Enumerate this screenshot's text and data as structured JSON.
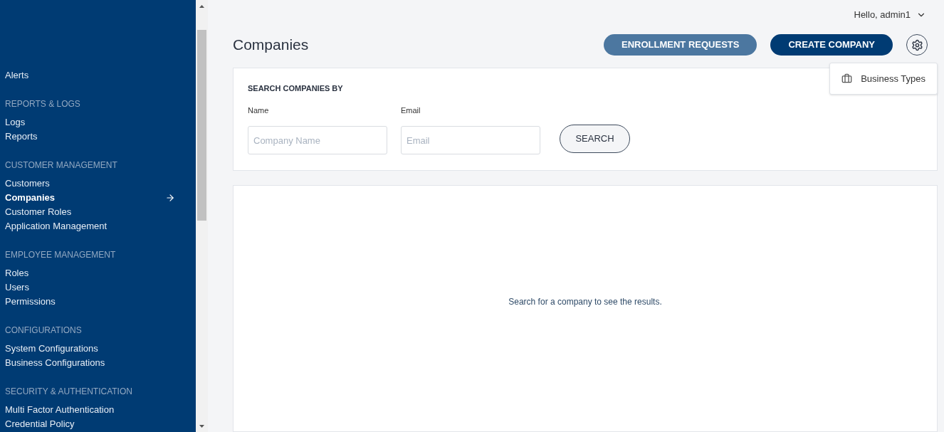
{
  "sidebar": {
    "groups": [
      {
        "items": [
          {
            "label": "Alerts",
            "selected": false
          }
        ]
      },
      {
        "header": "REPORTS & LOGS",
        "items": [
          {
            "label": "Logs",
            "selected": false
          },
          {
            "label": "Reports",
            "selected": false
          }
        ]
      },
      {
        "header": "CUSTOMER MANAGEMENT",
        "items": [
          {
            "label": "Customers",
            "selected": false
          },
          {
            "label": "Companies",
            "selected": true
          },
          {
            "label": "Customer Roles",
            "selected": false
          },
          {
            "label": "Application Management",
            "selected": false
          }
        ]
      },
      {
        "header": "EMPLOYEE MANAGEMENT",
        "items": [
          {
            "label": "Roles",
            "selected": false
          },
          {
            "label": "Users",
            "selected": false
          },
          {
            "label": "Permissions",
            "selected": false
          }
        ]
      },
      {
        "header": "CONFIGURATIONS",
        "items": [
          {
            "label": "System Configurations",
            "selected": false
          },
          {
            "label": "Business Configurations",
            "selected": false
          }
        ]
      },
      {
        "header": "SECURITY & AUTHENTICATION",
        "items": [
          {
            "label": "Multi Factor Authentication",
            "selected": false
          },
          {
            "label": "Credential Policy",
            "selected": false
          }
        ]
      }
    ]
  },
  "user_menu": {
    "label": "Hello, admin1"
  },
  "page_title": "Companies",
  "actions": [
    {
      "label": "ENROLLMENT REQUESTS",
      "kind": "secondary"
    },
    {
      "label": "CREATE COMPANY",
      "kind": "primary"
    }
  ],
  "settings_menu": {
    "items": [
      {
        "label": "Business Types"
      }
    ]
  },
  "search": {
    "title": "SEARCH COMPANIES BY",
    "fields": [
      {
        "label": "Name",
        "placeholder": "Company Name"
      },
      {
        "label": "Email",
        "placeholder": "Email"
      }
    ],
    "button": "SEARCH"
  },
  "results": {
    "message": "Search for a company to see the results."
  }
}
